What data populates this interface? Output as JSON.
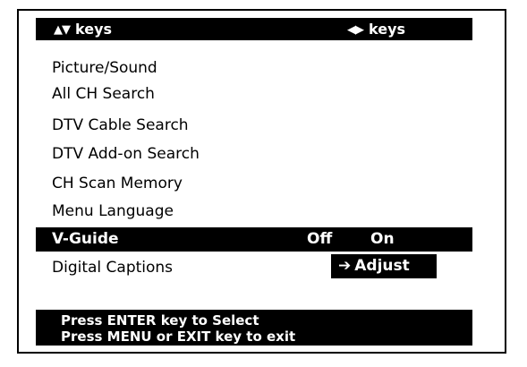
{
  "header": {
    "left_glyph": "▲▼",
    "left_label": "keys",
    "right_glyph": "◀▶",
    "right_label": "keys"
  },
  "menu": {
    "items": [
      {
        "label": "Picture/Sound"
      },
      {
        "label": "All CH Search"
      },
      {
        "label": "DTV Cable Search"
      },
      {
        "label": "DTV Add-on Search"
      },
      {
        "label": "CH Scan Memory"
      },
      {
        "label": "Menu Language"
      }
    ],
    "selected": {
      "label": "V-Guide",
      "off": "Off",
      "on": "On"
    },
    "last": {
      "label": "Digital Captions",
      "action_arrow": "➔",
      "action_label": "Adjust"
    }
  },
  "footer": {
    "line1": "Press ENTER key to Select",
    "line2": "Press MENU or EXIT key to exit"
  },
  "colors": {
    "background": "#ffffff",
    "bar": "#000000",
    "text_on_bar": "#ffffff",
    "text": "#000000"
  }
}
